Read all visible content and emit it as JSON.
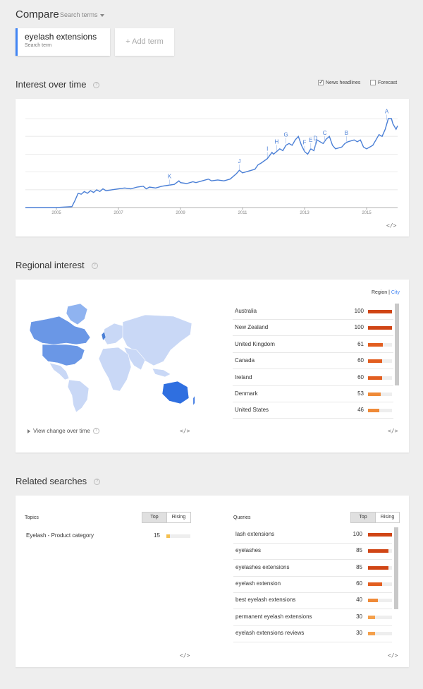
{
  "compare": {
    "title": "Compare",
    "search_terms_label": "Search terms"
  },
  "term": {
    "name": "eyelash extensions",
    "sub": "Search term"
  },
  "add_term": "+ Add term",
  "interest": {
    "title": "Interest over time",
    "news_headlines": "News headlines",
    "forecast": "Forecast",
    "embed": "</>"
  },
  "chart_data": {
    "type": "line",
    "x_ticks": [
      "2005",
      "2007",
      "2009",
      "2011",
      "2013",
      "2015"
    ],
    "x_range": [
      2004.0,
      2016.0
    ],
    "y_range": [
      0,
      100
    ],
    "series": [
      {
        "values": [
          [
            2004.0,
            0
          ],
          [
            2005.0,
            0
          ],
          [
            2005.5,
            1
          ],
          [
            2005.6,
            8
          ],
          [
            2005.7,
            16
          ],
          [
            2005.8,
            15
          ],
          [
            2005.9,
            18
          ],
          [
            2006.0,
            16
          ],
          [
            2006.1,
            19
          ],
          [
            2006.2,
            17
          ],
          [
            2006.3,
            20
          ],
          [
            2006.4,
            18
          ],
          [
            2006.5,
            21
          ],
          [
            2006.6,
            19
          ],
          [
            2006.8,
            20
          ],
          [
            2007.0,
            21
          ],
          [
            2007.2,
            22
          ],
          [
            2007.4,
            21
          ],
          [
            2007.6,
            23
          ],
          [
            2007.8,
            24
          ],
          [
            2007.9,
            21
          ],
          [
            2008.0,
            23
          ],
          [
            2008.2,
            22
          ],
          [
            2008.4,
            24
          ],
          [
            2008.6,
            25
          ],
          [
            2008.8,
            26
          ],
          [
            2008.95,
            30
          ],
          [
            2009.0,
            28
          ],
          [
            2009.2,
            27
          ],
          [
            2009.4,
            29
          ],
          [
            2009.5,
            28
          ],
          [
            2009.7,
            30
          ],
          [
            2009.9,
            32
          ],
          [
            2010.0,
            30
          ],
          [
            2010.2,
            31
          ],
          [
            2010.4,
            30
          ],
          [
            2010.6,
            32
          ],
          [
            2010.8,
            38
          ],
          [
            2010.9,
            42
          ],
          [
            2011.0,
            39
          ],
          [
            2011.2,
            41
          ],
          [
            2011.4,
            43
          ],
          [
            2011.5,
            48
          ],
          [
            2011.6,
            50
          ],
          [
            2011.8,
            55
          ],
          [
            2011.95,
            62
          ],
          [
            2012.0,
            60
          ],
          [
            2012.2,
            66
          ],
          [
            2012.3,
            64
          ],
          [
            2012.4,
            70
          ],
          [
            2012.5,
            72
          ],
          [
            2012.6,
            70
          ],
          [
            2012.7,
            76
          ],
          [
            2012.8,
            80
          ],
          [
            2012.9,
            70
          ],
          [
            2013.0,
            63
          ],
          [
            2013.1,
            60
          ],
          [
            2013.2,
            66
          ],
          [
            2013.3,
            64
          ],
          [
            2013.4,
            76
          ],
          [
            2013.5,
            74
          ],
          [
            2013.6,
            72
          ],
          [
            2013.7,
            77
          ],
          [
            2013.8,
            80
          ],
          [
            2013.9,
            70
          ],
          [
            2014.0,
            66
          ],
          [
            2014.2,
            68
          ],
          [
            2014.3,
            72
          ],
          [
            2014.4,
            74
          ],
          [
            2014.6,
            76
          ],
          [
            2014.7,
            74
          ],
          [
            2014.8,
            76
          ],
          [
            2014.9,
            68
          ],
          [
            2015.0,
            66
          ],
          [
            2015.2,
            70
          ],
          [
            2015.4,
            82
          ],
          [
            2015.5,
            80
          ],
          [
            2015.6,
            88
          ],
          [
            2015.7,
            100
          ],
          [
            2015.8,
            100
          ],
          [
            2015.85,
            94
          ],
          [
            2015.95,
            88
          ],
          [
            2016.0,
            92
          ]
        ]
      }
    ],
    "annotations": [
      {
        "label": "K",
        "x": 2008.65,
        "y": 25
      },
      {
        "label": "J",
        "x": 2010.9,
        "y": 42
      },
      {
        "label": "I",
        "x": 2011.8,
        "y": 56
      },
      {
        "label": "H",
        "x": 2012.1,
        "y": 64
      },
      {
        "label": "G",
        "x": 2012.4,
        "y": 72
      },
      {
        "label": "F",
        "x": 2013.0,
        "y": 63
      },
      {
        "label": "E",
        "x": 2013.2,
        "y": 66
      },
      {
        "label": "D",
        "x": 2013.35,
        "y": 68
      },
      {
        "label": "C",
        "x": 2013.65,
        "y": 74
      },
      {
        "label": "B",
        "x": 2014.35,
        "y": 74
      },
      {
        "label": "A",
        "x": 2015.65,
        "y": 98
      }
    ],
    "color": "#4a7fd6"
  },
  "regional": {
    "title": "Regional interest",
    "region_label": "Region",
    "city_label": "City",
    "view_change": "View change over time",
    "embed": "</>",
    "rows": [
      {
        "name": "Australia",
        "value": "100",
        "pct": 1.0,
        "color": "#d04515"
      },
      {
        "name": "New Zealand",
        "value": "100",
        "pct": 1.0,
        "color": "#d04515"
      },
      {
        "name": "United Kingdom",
        "value": "61",
        "pct": 0.61,
        "color": "#e25e20"
      },
      {
        "name": "Canada",
        "value": "60",
        "pct": 0.6,
        "color": "#e25e20"
      },
      {
        "name": "Ireland",
        "value": "60",
        "pct": 0.6,
        "color": "#e25e20"
      },
      {
        "name": "Denmark",
        "value": "53",
        "pct": 0.53,
        "color": "#ef8a38"
      },
      {
        "name": "United States",
        "value": "46",
        "pct": 0.46,
        "color": "#ef8a38"
      }
    ]
  },
  "related": {
    "title": "Related searches",
    "topics_label": "Topics",
    "queries_label": "Queries",
    "top_label": "Top",
    "rising_label": "Rising",
    "embed": "</>",
    "topics": [
      {
        "name": "Eyelash - Product category",
        "value": "15",
        "pct": 0.15
      }
    ],
    "queries": [
      {
        "name": "lash extensions",
        "value": "100",
        "pct": 1.0,
        "color": "#d04515"
      },
      {
        "name": "eyelashes",
        "value": "85",
        "pct": 0.85,
        "color": "#d04515"
      },
      {
        "name": "eyelashes extensions",
        "value": "85",
        "pct": 0.85,
        "color": "#d04515"
      },
      {
        "name": "eyelash extension",
        "value": "60",
        "pct": 0.6,
        "color": "#e25e20"
      },
      {
        "name": "best eyelash extensions",
        "value": "40",
        "pct": 0.4,
        "color": "#ef8a38"
      },
      {
        "name": "permanent eyelash extensions",
        "value": "30",
        "pct": 0.3,
        "color": "#f4a04c"
      },
      {
        "name": "eyelash extensions reviews",
        "value": "30",
        "pct": 0.3,
        "color": "#f4a04c"
      }
    ]
  }
}
